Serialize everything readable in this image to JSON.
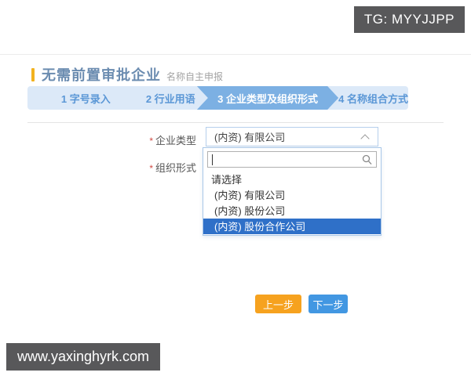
{
  "overlays": {
    "top_right_badge": "TG: MYYJJPP",
    "bottom_left_badge": "www.yaxinghyrk.com"
  },
  "header": {
    "title": "无需前置审批企业",
    "subtitle": "名称自主申报"
  },
  "steps": [
    {
      "label": "1 字号录入",
      "active": false
    },
    {
      "label": "2 行业用语",
      "active": false
    },
    {
      "label": "3 企业类型及组织形式",
      "active": true
    },
    {
      "label": "4 名称组合方式",
      "active": false
    }
  ],
  "form": {
    "fields": [
      {
        "required_mark": "*",
        "label": "企业类型",
        "value": "(内资) 有限公司"
      },
      {
        "required_mark": "*",
        "label": "组织形式",
        "value": ""
      }
    ],
    "dropdown": {
      "search_value": "",
      "search_icon": "magnifier",
      "options": [
        {
          "label": "请选择",
          "selected": false
        },
        {
          "label": "(内资) 有限公司",
          "selected": false
        },
        {
          "label": "(内资) 股份公司",
          "selected": false
        },
        {
          "label": "(内资) 股份合作公司",
          "selected": true
        }
      ]
    }
  },
  "buttons": {
    "prev": "上一步",
    "next": "下一步"
  },
  "colors": {
    "accent_orange": "#f2b21e",
    "step_bar_bg": "#dce9f8",
    "step_active_bg": "#7cb0e3",
    "step_text_blue": "#5b97d6",
    "selected_option_bg": "#2f70c8",
    "button_prev_orange": "#f6a21f",
    "button_next_blue": "#4297e2",
    "badge_bg": "#58585a"
  }
}
